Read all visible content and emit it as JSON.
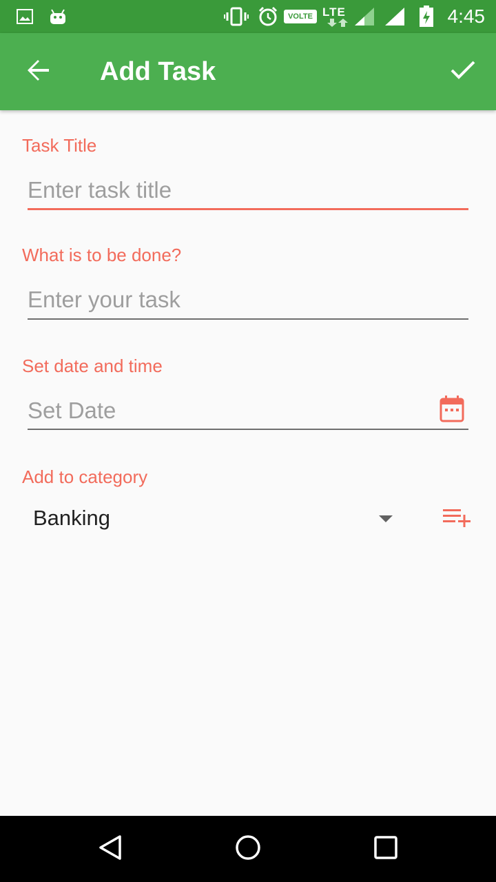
{
  "status_bar": {
    "time": "4:45",
    "volte": "VOLTE",
    "network": "LTE",
    "icons": [
      "image-icon",
      "android-icon",
      "vibrate-icon",
      "alarm-icon",
      "signal-icon",
      "signal-icon",
      "battery-charging-icon"
    ]
  },
  "app_bar": {
    "title": "Add Task",
    "back_icon": "back-arrow-icon",
    "save_icon": "check-icon"
  },
  "form": {
    "task_title_label": "Task Title",
    "task_title_placeholder": "Enter task title",
    "task_label": "What is to be done?",
    "task_placeholder": "Enter your task",
    "date_label": "Set date and time",
    "date_placeholder": "Set Date",
    "category_label": "Add to category",
    "category_selected": "Banking"
  },
  "colors": {
    "primary": "#4caf50",
    "primary_dark": "#3a9a3a",
    "accent": "#f26b5b"
  }
}
